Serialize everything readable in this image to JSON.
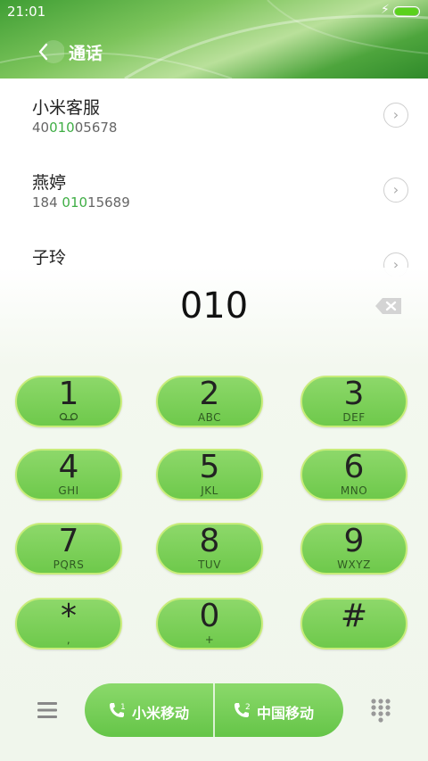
{
  "status": {
    "time": "21:01",
    "battery_level": 1.0
  },
  "nav": {
    "title": "通话"
  },
  "contacts": [
    {
      "name": "小米客服",
      "num_pre": "40",
      "num_hl": "010",
      "num_post": "05678"
    },
    {
      "name": "燕婷",
      "num_pre": "184 ",
      "num_hl": "010",
      "num_post": "15689"
    },
    {
      "name": "子玲",
      "num_pre": "",
      "num_hl": "",
      "num_post": ""
    }
  ],
  "dialer": {
    "entry": "010",
    "keys": [
      {
        "digit": "1",
        "sub": "voicemail-icon"
      },
      {
        "digit": "2",
        "sub": "ABC"
      },
      {
        "digit": "3",
        "sub": "DEF"
      },
      {
        "digit": "4",
        "sub": "GHI"
      },
      {
        "digit": "5",
        "sub": "JKL"
      },
      {
        "digit": "6",
        "sub": "MNO"
      },
      {
        "digit": "7",
        "sub": "PQRS"
      },
      {
        "digit": "8",
        "sub": "TUV"
      },
      {
        "digit": "9",
        "sub": "WXYZ"
      },
      {
        "digit": "*",
        "sub": ","
      },
      {
        "digit": "0",
        "sub": "+"
      },
      {
        "digit": "#",
        "sub": ""
      }
    ]
  },
  "call_buttons": [
    {
      "sim": "1",
      "label": "小米移动"
    },
    {
      "sim": "2",
      "label": "中国移动"
    }
  ],
  "colors": {
    "accent": "#3fae45",
    "key_fill": "#7ccf58",
    "key_border": "#c8ec7a"
  }
}
